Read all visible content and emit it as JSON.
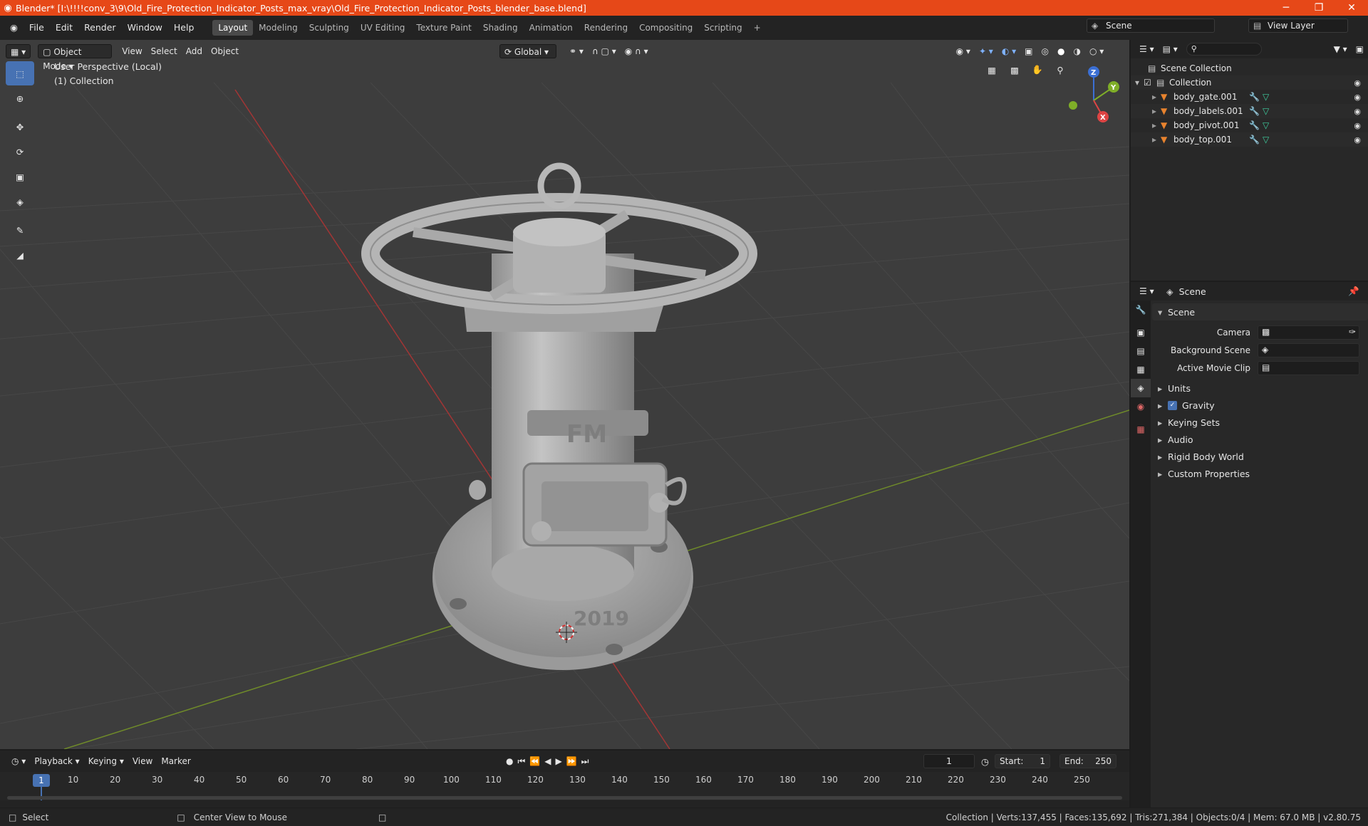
{
  "window": {
    "title": "Blender* [I:\\!!!!conv_3\\9\\Old_Fire_Protection_Indicator_Posts_max_vray\\Old_Fire_Protection_Indicator_Posts_blender_base.blend]",
    "minimize": "─",
    "maximize": "❐",
    "close": "✕"
  },
  "menu": [
    "File",
    "Edit",
    "Render",
    "Window",
    "Help"
  ],
  "workspaces": [
    "Layout",
    "Modeling",
    "Sculpting",
    "UV Editing",
    "Texture Paint",
    "Shading",
    "Animation",
    "Rendering",
    "Compositing",
    "Scripting"
  ],
  "topbar": {
    "scene": "Scene",
    "view_layer": "View Layer"
  },
  "viewport": {
    "mode": "Object Mode",
    "menus": [
      "View",
      "Select",
      "Add",
      "Object"
    ],
    "orientation": "Global",
    "perspective_label": "User Perspective (Local)",
    "collection_label": "(1) Collection",
    "model_text_logo": "FM",
    "model_text_year": "2019"
  },
  "gizmo": {
    "z": "Z",
    "y": "Y",
    "x": "X"
  },
  "outliner": {
    "scene_collection": "Scene Collection",
    "collection": "Collection",
    "items": [
      "body_gate.001",
      "body_labels.001",
      "body_pivot.001",
      "body_top.001"
    ]
  },
  "properties": {
    "header": "Scene",
    "section": "Scene",
    "camera_label": "Camera",
    "background_label": "Background Scene",
    "clip_label": "Active Movie Clip",
    "subsections": [
      "Units",
      "Gravity",
      "Keying Sets",
      "Audio",
      "Rigid Body World",
      "Custom Properties"
    ]
  },
  "timeline": {
    "menus": [
      "Playback",
      "Keying",
      "View",
      "Marker"
    ],
    "current_frame": "1",
    "start_label": "Start:",
    "start": "1",
    "end_label": "End:",
    "end": "250",
    "ticks": [
      "10",
      "20",
      "30",
      "40",
      "50",
      "60",
      "70",
      "80",
      "90",
      "100",
      "110",
      "120",
      "130",
      "140",
      "150",
      "160",
      "170",
      "180",
      "190",
      "200",
      "210",
      "220",
      "230",
      "240",
      "250"
    ]
  },
  "status": {
    "select": "Select",
    "center": "Center View to Mouse",
    "stats": "Collection | Verts:137,455 | Faces:135,692 | Tris:271,384 | Objects:0/4 | Mem: 67.0 MB | v2.80.75"
  },
  "colors": {
    "title_bar": "#e64818",
    "accent": "#4772b3",
    "viewport_bg": "#3d3d3d",
    "object_orange": "#e8832e"
  }
}
